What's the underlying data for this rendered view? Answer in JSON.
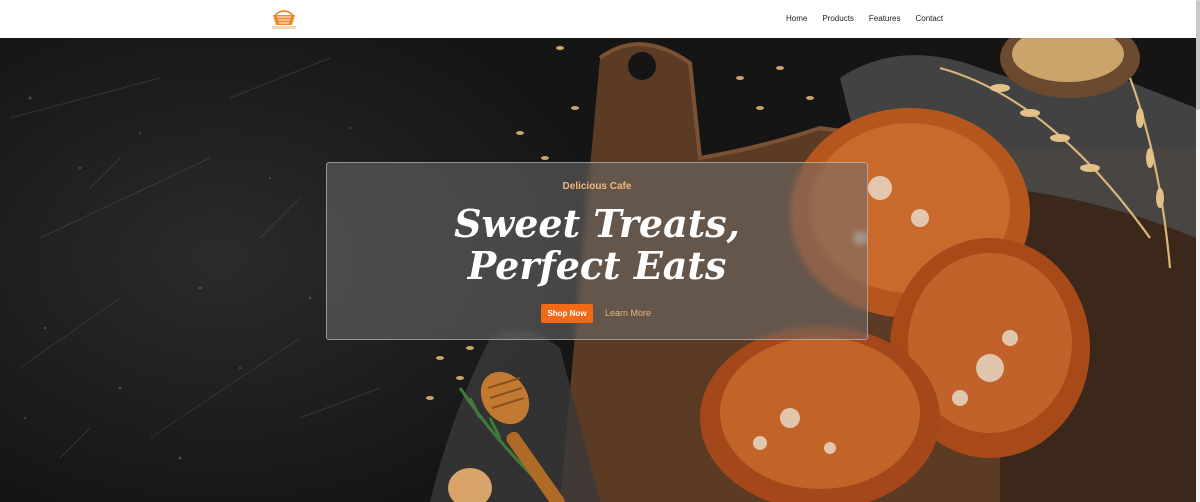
{
  "nav": {
    "logo_icon": "basket-logo-icon",
    "links": [
      "Home",
      "Products",
      "Features",
      "Contact"
    ]
  },
  "hero": {
    "eyebrow": "Delicious Cafe",
    "headline_line1": "Sweet Treats,",
    "headline_line2": "Perfect Eats",
    "primary_button": "Shop Now",
    "secondary_button": "Learn More"
  },
  "colors": {
    "accent": "#f36a14",
    "eyebrow": "#f0b77d",
    "dark_bg": "#1b1b1b"
  }
}
